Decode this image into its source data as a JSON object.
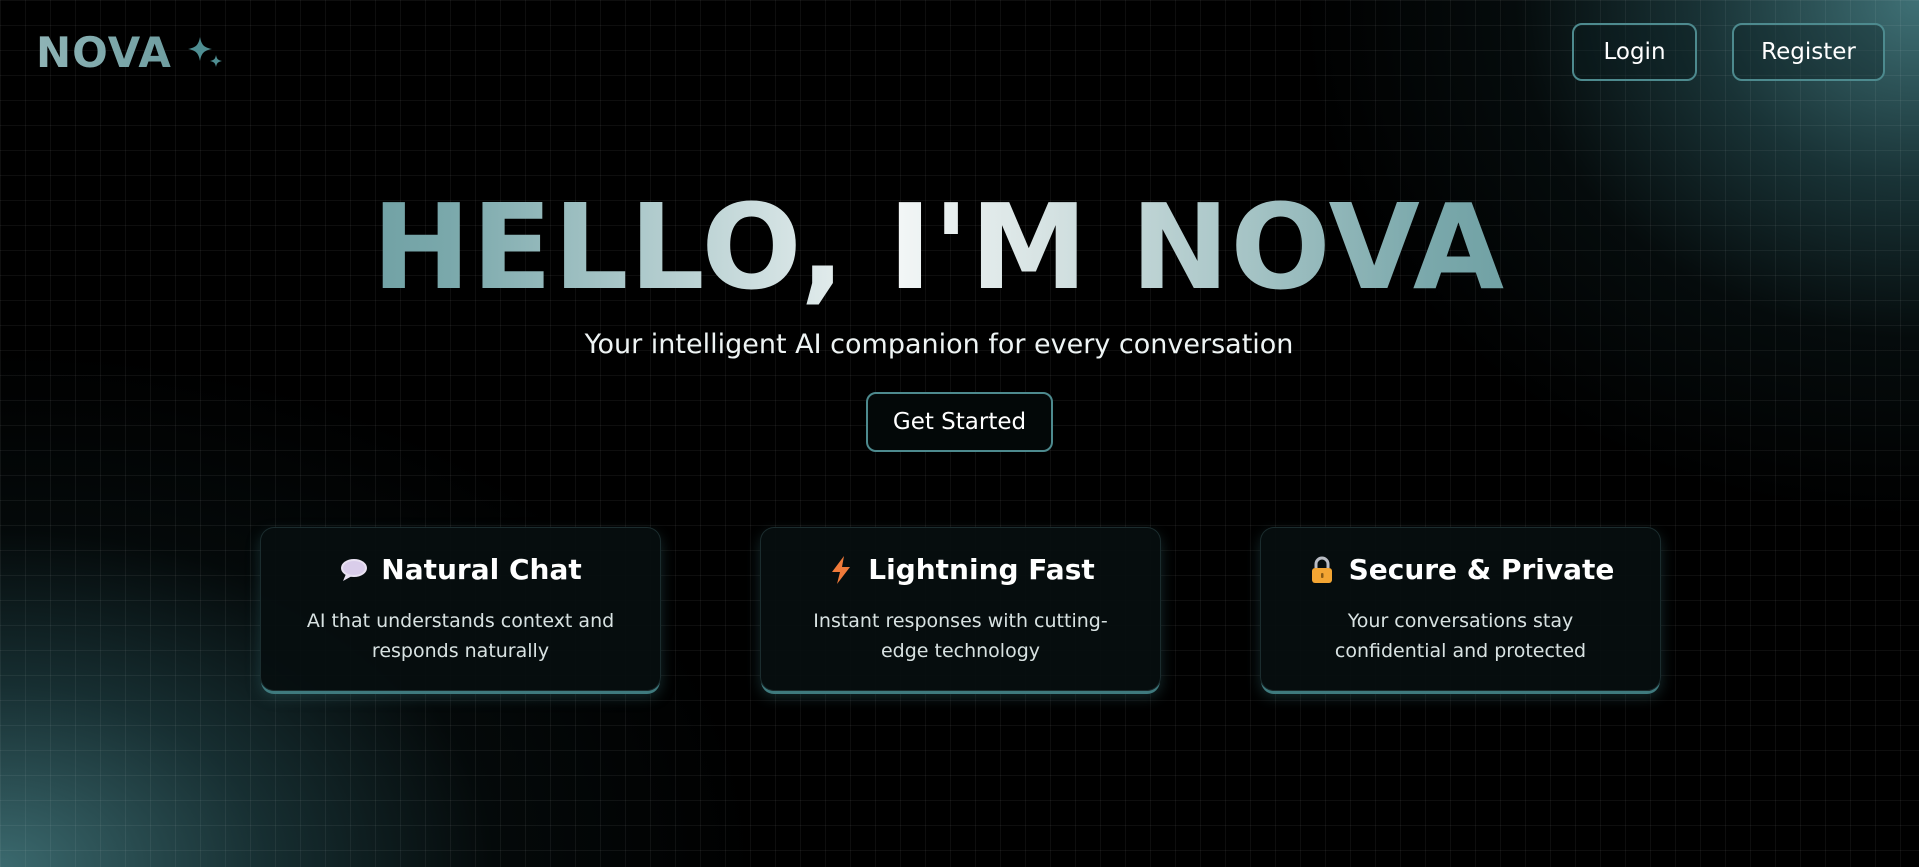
{
  "brand": {
    "name": "NOVA",
    "icon": "sparkle-icon"
  },
  "nav": {
    "login_label": "Login",
    "register_label": "Register"
  },
  "hero": {
    "title": "HELLO, I'M NOVA",
    "subtitle": "Your intelligent AI companion for every conversation",
    "cta_label": "Get Started"
  },
  "features": [
    {
      "icon": "speech-bubble-icon",
      "title": "Natural Chat",
      "description": "AI that understands context and responds naturally"
    },
    {
      "icon": "lightning-icon",
      "title": "Lightning Fast",
      "description": "Instant responses with cutting-edge technology"
    },
    {
      "icon": "lock-icon",
      "title": "Secure & Private",
      "description": "Your conversations stay confidential and protected"
    }
  ],
  "colors": {
    "accent": "#4d8a8e",
    "background": "#000000",
    "glow": "#4a848a"
  }
}
